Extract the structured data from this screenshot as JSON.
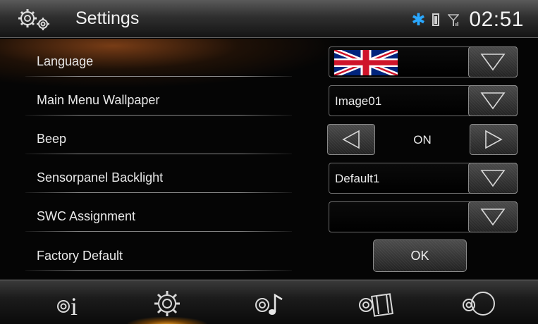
{
  "header": {
    "title": "Settings",
    "time": "02:51",
    "icons": [
      "gears-icon",
      "bluetooth-icon",
      "battery-icon",
      "signal-icon"
    ]
  },
  "settings": {
    "language": {
      "label": "Language",
      "value_icon": "uk-flag-icon"
    },
    "wallpaper": {
      "label": "Main Menu Wallpaper",
      "value": "Image01"
    },
    "beep": {
      "label": "Beep",
      "value": "ON"
    },
    "backlight": {
      "label": "Sensorpanel Backlight",
      "value": "Default1"
    },
    "swc": {
      "label": "SWC Assignment",
      "value": ""
    },
    "factory": {
      "label": "Factory Default",
      "button_label": "OK"
    }
  },
  "bottom_nav": {
    "items": [
      "info-icon",
      "settings-gear-icon",
      "audio-settings-icon",
      "video-settings-icon",
      "navigation-compass-icon"
    ],
    "active": "settings-gear-icon"
  },
  "colors": {
    "bluetooth": "#2aa8ff",
    "active_glow": "#ffaa28",
    "header_glow": "#8c4619"
  }
}
